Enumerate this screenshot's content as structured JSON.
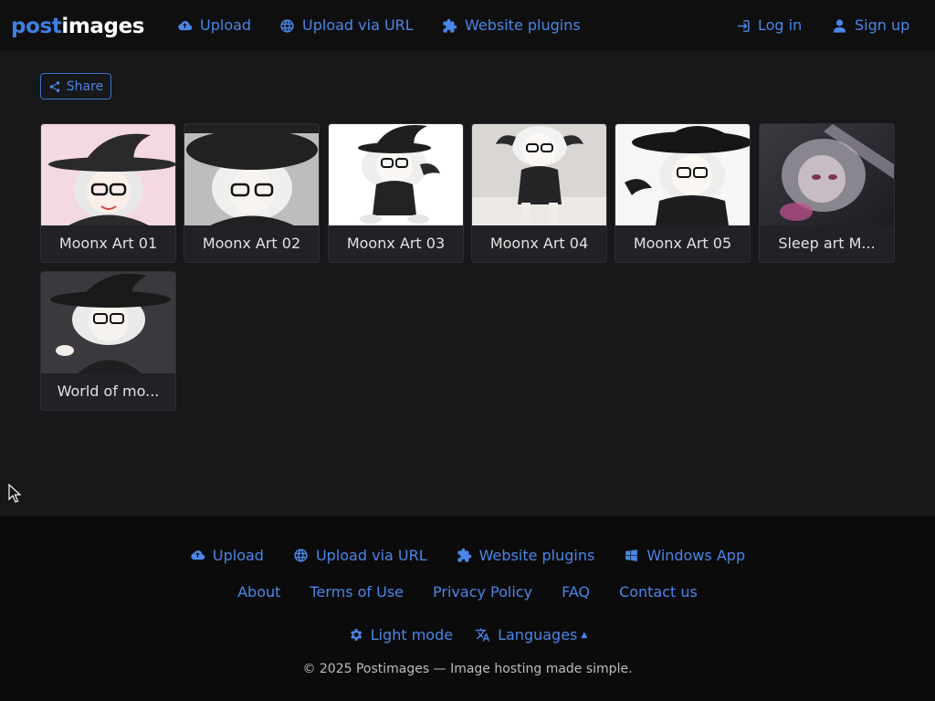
{
  "header": {
    "logo_part1": "post",
    "logo_part2": "images",
    "nav": [
      {
        "label": "Upload",
        "icon": "cloud-upload-icon"
      },
      {
        "label": "Upload via URL",
        "icon": "globe-icon"
      },
      {
        "label": "Website plugins",
        "icon": "puzzle-icon"
      }
    ],
    "auth": [
      {
        "label": "Log in",
        "icon": "sign-in-icon"
      },
      {
        "label": "Sign up",
        "icon": "user-icon"
      }
    ]
  },
  "share": {
    "label": "Share",
    "icon": "share-icon"
  },
  "gallery": {
    "items": [
      {
        "title": "Moonx Art 01"
      },
      {
        "title": "Moonx Art 02"
      },
      {
        "title": "Moonx Art 03"
      },
      {
        "title": "Moonx Art 04"
      },
      {
        "title": "Moonx Art 05"
      },
      {
        "title": "Sleep art M..."
      },
      {
        "title": "World of mo..."
      }
    ]
  },
  "footer": {
    "links_primary": [
      {
        "label": "Upload",
        "icon": "cloud-upload-icon"
      },
      {
        "label": "Upload via URL",
        "icon": "globe-icon"
      },
      {
        "label": "Website plugins",
        "icon": "puzzle-icon"
      },
      {
        "label": "Windows App",
        "icon": "windows-icon"
      }
    ],
    "links_secondary": [
      "About",
      "Terms of Use",
      "Privacy Policy",
      "FAQ",
      "Contact us"
    ],
    "theme_toggle": {
      "label": "Light mode",
      "icon": "gear-icon"
    },
    "languages": {
      "label": "Languages",
      "icon": "translate-icon"
    },
    "copyright": "© 2025 Postimages — Image hosting made simple."
  },
  "colors": {
    "accent": "#4a86e8",
    "background": "#18171a",
    "header_bg": "#0f0f10",
    "footer_bg": "#0b0b0c"
  }
}
